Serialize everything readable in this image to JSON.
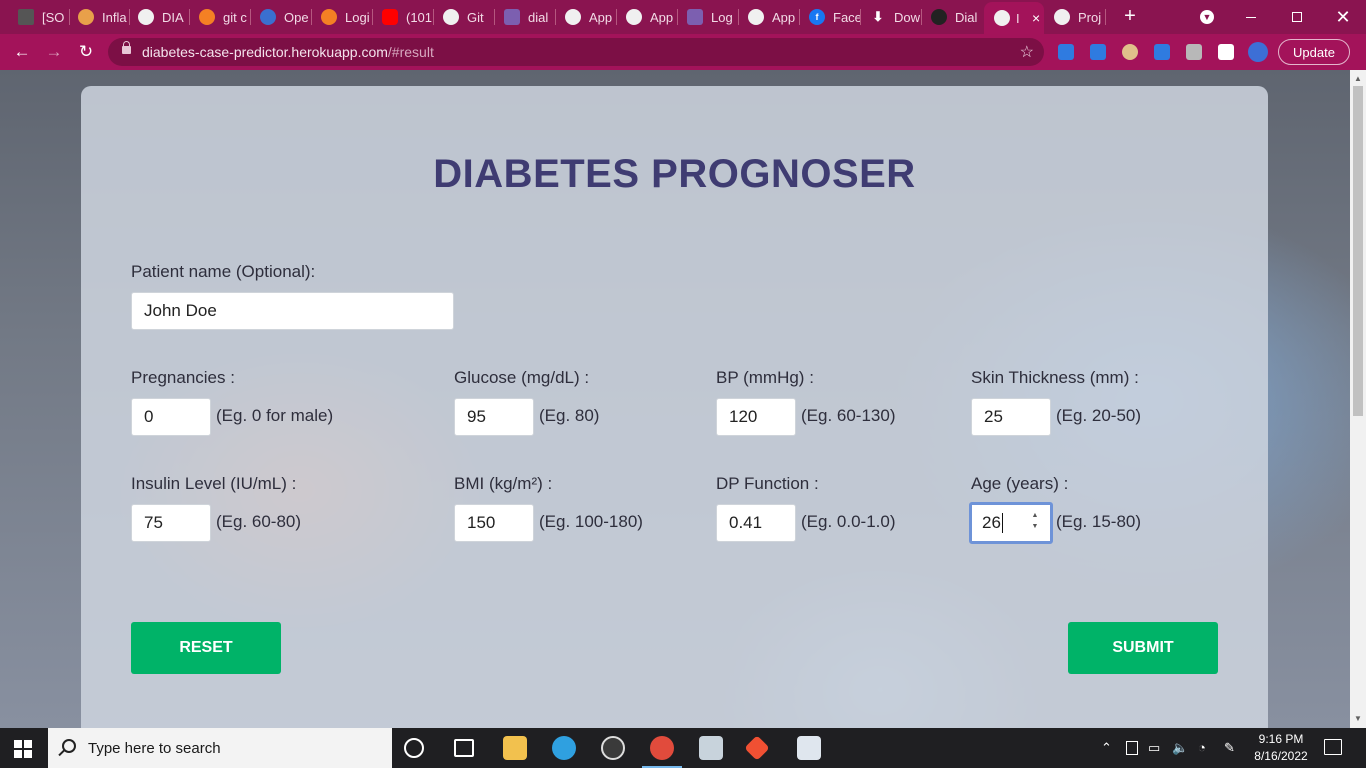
{
  "browser": {
    "tabs": [
      {
        "title": "[SO"
      },
      {
        "title": "Infla"
      },
      {
        "title": "DIA"
      },
      {
        "title": "git c"
      },
      {
        "title": "Ope"
      },
      {
        "title": "Logi"
      },
      {
        "title": "(101"
      },
      {
        "title": "Git"
      },
      {
        "title": "dial"
      },
      {
        "title": "App"
      },
      {
        "title": "App"
      },
      {
        "title": "Log"
      },
      {
        "title": "App"
      },
      {
        "title": "Face"
      },
      {
        "title": "Dow"
      },
      {
        "title": "Dial"
      },
      {
        "title": "I"
      },
      {
        "title": "Proj"
      }
    ],
    "url_host": "diabetes-case-predictor.herokuapp.com",
    "url_path": "/#result",
    "update_label": "Update",
    "new_tab": "+",
    "close_tab": "×"
  },
  "page": {
    "title": "DIABETES PROGNOSER",
    "patient_name_label": "Patient name (Optional):",
    "patient_name_value": "John Doe",
    "fields": [
      {
        "label": "Pregnancies :",
        "value": "0",
        "hint": "(Eg. 0 for male)"
      },
      {
        "label": "Glucose (mg/dL) :",
        "value": "95",
        "hint": "(Eg. 80)"
      },
      {
        "label": "BP (mmHg) :",
        "value": "120",
        "hint": "(Eg. 60-130)"
      },
      {
        "label": "Skin Thickness (mm) :",
        "value": "25",
        "hint": "(Eg. 20-50)"
      },
      {
        "label": "Insulin Level (IU/mL) :",
        "value": "75",
        "hint": "(Eg. 60-80)"
      },
      {
        "label": "BMI (kg/m²) :",
        "value": "150",
        "hint": "(Eg. 100-180)"
      },
      {
        "label": "DP Function :",
        "value": "0.41",
        "hint": "(Eg. 0.0-1.0)"
      },
      {
        "label": "Age (years) :",
        "value": "26",
        "hint": "(Eg. 15-80)"
      }
    ],
    "reset_label": "RESET",
    "submit_label": "SUBMIT"
  },
  "taskbar": {
    "search_placeholder": "Type here to search",
    "time": "9:16 PM",
    "date": "8/16/2022"
  },
  "colors": {
    "tab_strip": "#8a1450",
    "toolbar": "#a3135a",
    "title": "#3f3c72",
    "button": "#00b368",
    "focus_ring": "#6e93d8"
  }
}
